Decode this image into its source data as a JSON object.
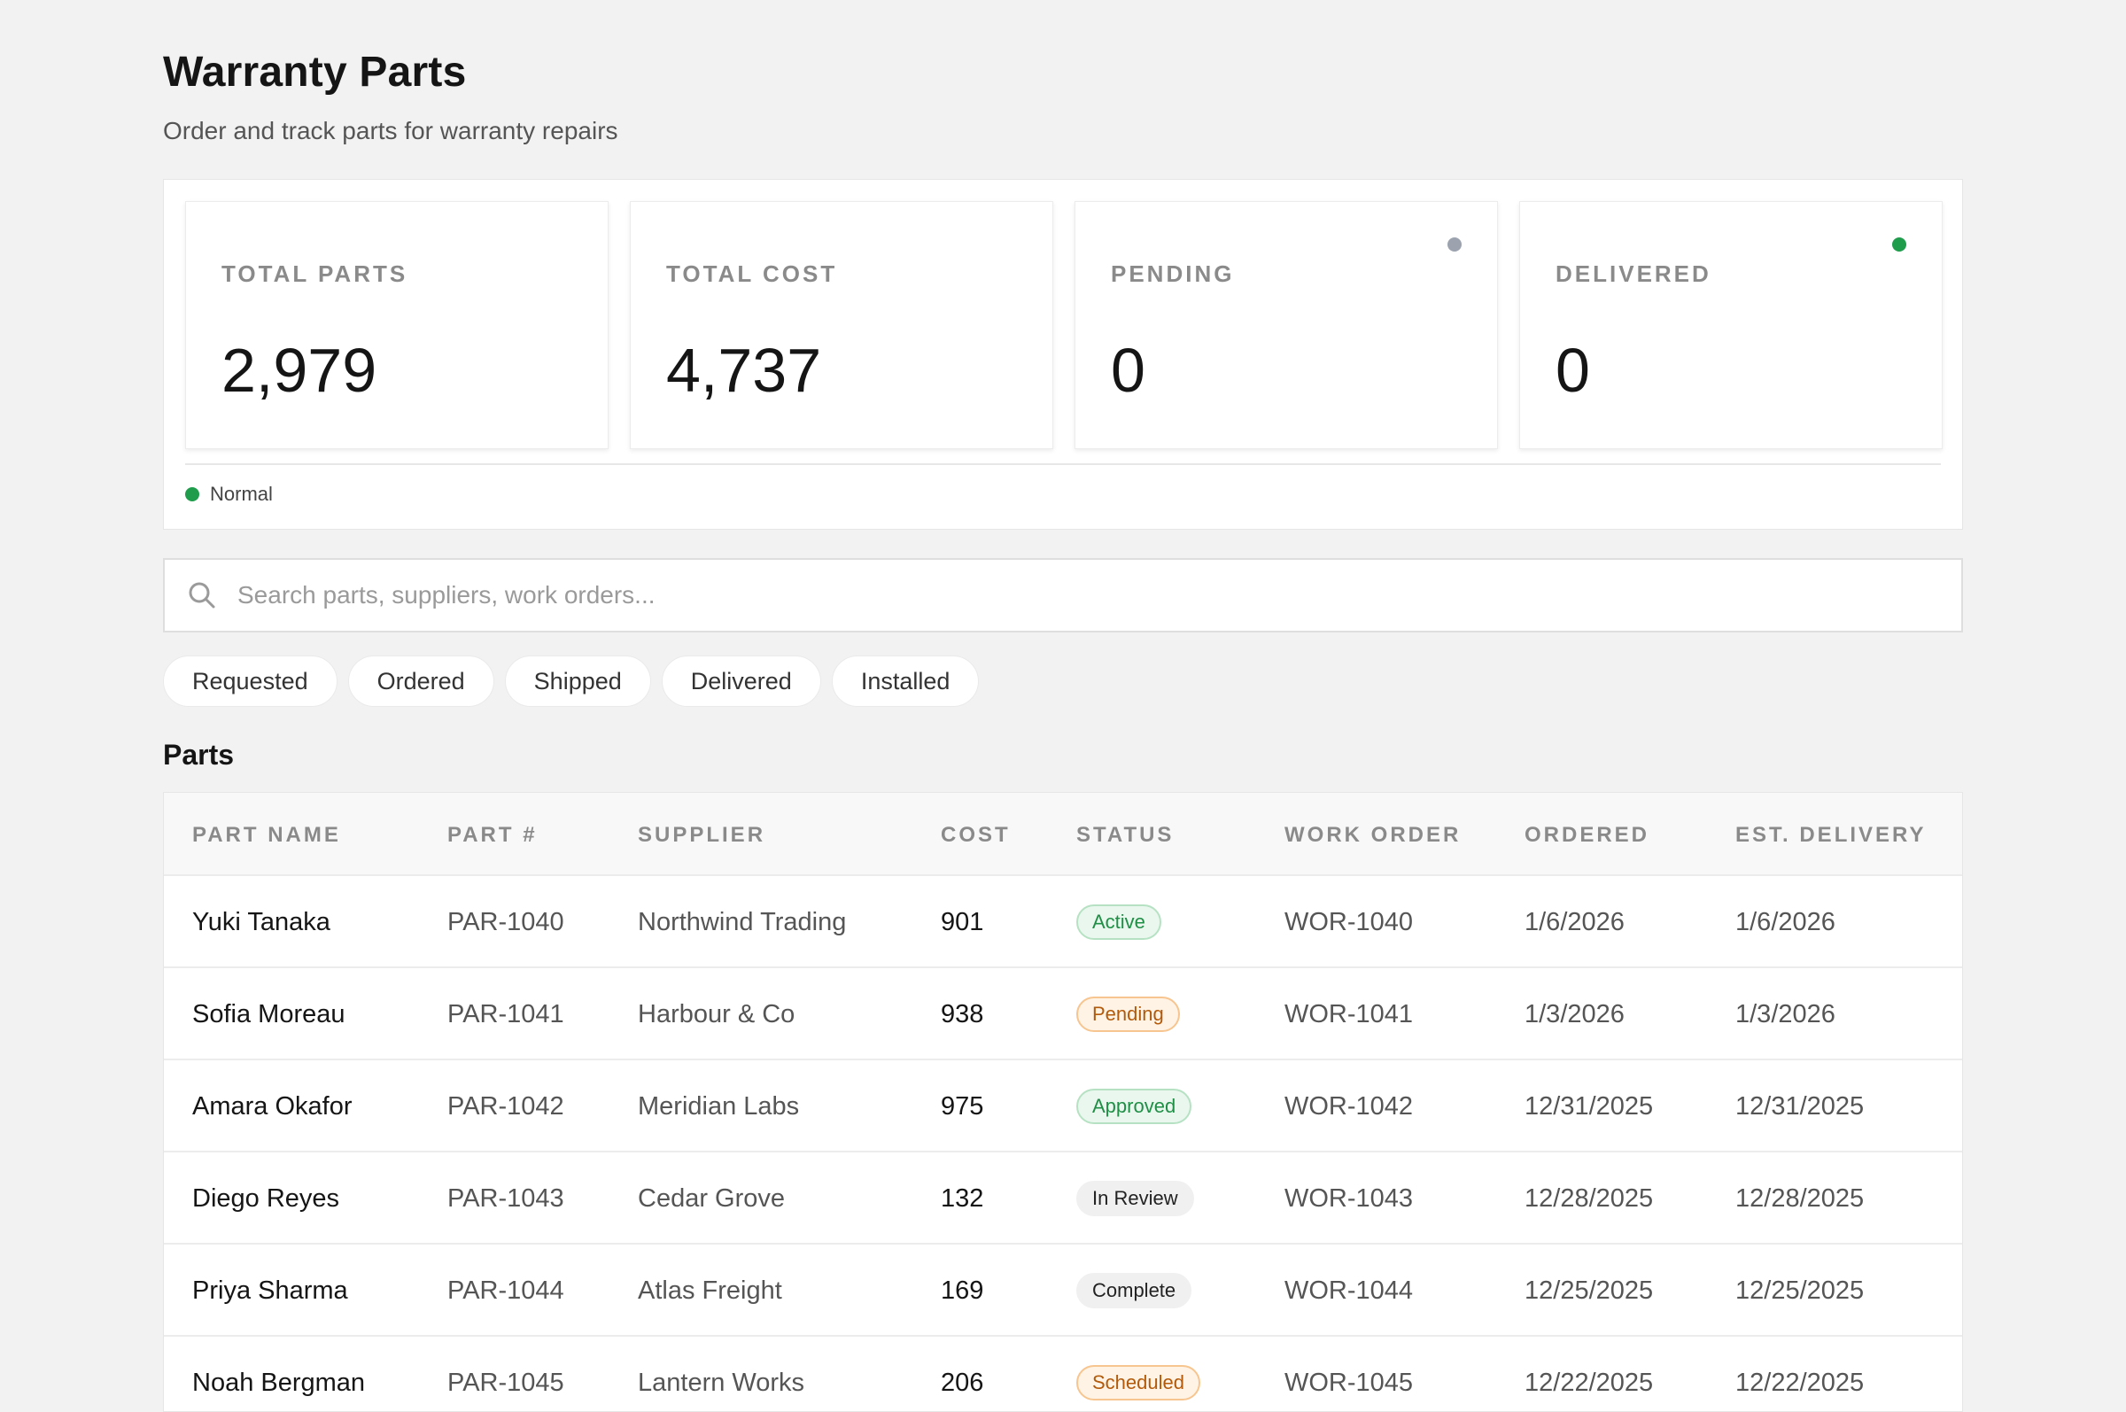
{
  "header": {
    "title": "Warranty Parts",
    "subtitle": "Order and track parts for warranty repairs"
  },
  "stats": [
    {
      "label": "TOTAL PARTS",
      "value": "2,979"
    },
    {
      "label": "TOTAL COST",
      "value": "4,737"
    },
    {
      "label": "PENDING",
      "value": "0",
      "dot_color": "#9ca3af"
    },
    {
      "label": "DELIVERED",
      "value": "0",
      "dot_color": "#1f9d4c"
    }
  ],
  "status_legend": {
    "label": "Normal",
    "color": "#1f9d4c"
  },
  "search": {
    "placeholder": "Search parts, suppliers, work orders...",
    "icon": "search-icon"
  },
  "filters": [
    "Requested",
    "Ordered",
    "Shipped",
    "Delivered",
    "Installed"
  ],
  "table": {
    "title": "Parts",
    "columns": [
      "PART NAME",
      "PART #",
      "SUPPLIER",
      "COST",
      "STATUS",
      "WORK ORDER",
      "ORDERED",
      "EST. DELIVERY"
    ],
    "rows": [
      {
        "name": "Yuki Tanaka",
        "part": "PAR-1040",
        "supplier": "Northwind Trading",
        "cost": "901",
        "status": "Active",
        "work_order": "WOR-1040",
        "ordered": "1/6/2026",
        "delivery": "1/6/2026"
      },
      {
        "name": "Sofia Moreau",
        "part": "PAR-1041",
        "supplier": "Harbour & Co",
        "cost": "938",
        "status": "Pending",
        "work_order": "WOR-1041",
        "ordered": "1/3/2026",
        "delivery": "1/3/2026"
      },
      {
        "name": "Amara Okafor",
        "part": "PAR-1042",
        "supplier": "Meridian Labs",
        "cost": "975",
        "status": "Approved",
        "work_order": "WOR-1042",
        "ordered": "12/31/2025",
        "delivery": "12/31/2025"
      },
      {
        "name": "Diego Reyes",
        "part": "PAR-1043",
        "supplier": "Cedar Grove",
        "cost": "132",
        "status": "In Review",
        "work_order": "WOR-1043",
        "ordered": "12/28/2025",
        "delivery": "12/28/2025"
      },
      {
        "name": "Priya Sharma",
        "part": "PAR-1044",
        "supplier": "Atlas Freight",
        "cost": "169",
        "status": "Complete",
        "work_order": "WOR-1044",
        "ordered": "12/25/2025",
        "delivery": "12/25/2025"
      },
      {
        "name": "Noah Bergman",
        "part": "PAR-1045",
        "supplier": "Lantern Works",
        "cost": "206",
        "status": "Scheduled",
        "work_order": "WOR-1045",
        "ordered": "12/22/2025",
        "delivery": "12/22/2025"
      }
    ]
  },
  "status_colors": {
    "green": "#1f8f46",
    "orange": "#b35a0a",
    "gray": "#222222"
  }
}
